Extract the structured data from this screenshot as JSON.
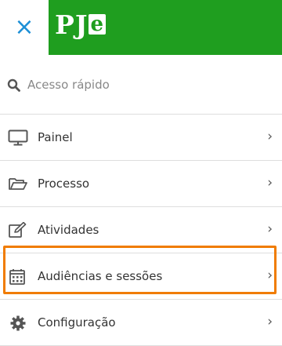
{
  "header": {
    "close_label": "×",
    "logo_main": "PJ",
    "logo_accent": "e"
  },
  "search": {
    "placeholder": "Acesso rápido"
  },
  "menu": {
    "items": [
      {
        "label": "Painel",
        "icon": "monitor-icon"
      },
      {
        "label": "Processo",
        "icon": "folder-icon"
      },
      {
        "label": "Atividades",
        "icon": "edit-icon"
      },
      {
        "label": "Audiências e sessões",
        "icon": "calendar-icon"
      },
      {
        "label": "Configuração",
        "icon": "gear-icon"
      }
    ],
    "chevron": "›"
  },
  "colors": {
    "brand_green": "#1f9e1f",
    "close_blue": "#1c8fd6",
    "highlight_orange": "#f07c00"
  }
}
